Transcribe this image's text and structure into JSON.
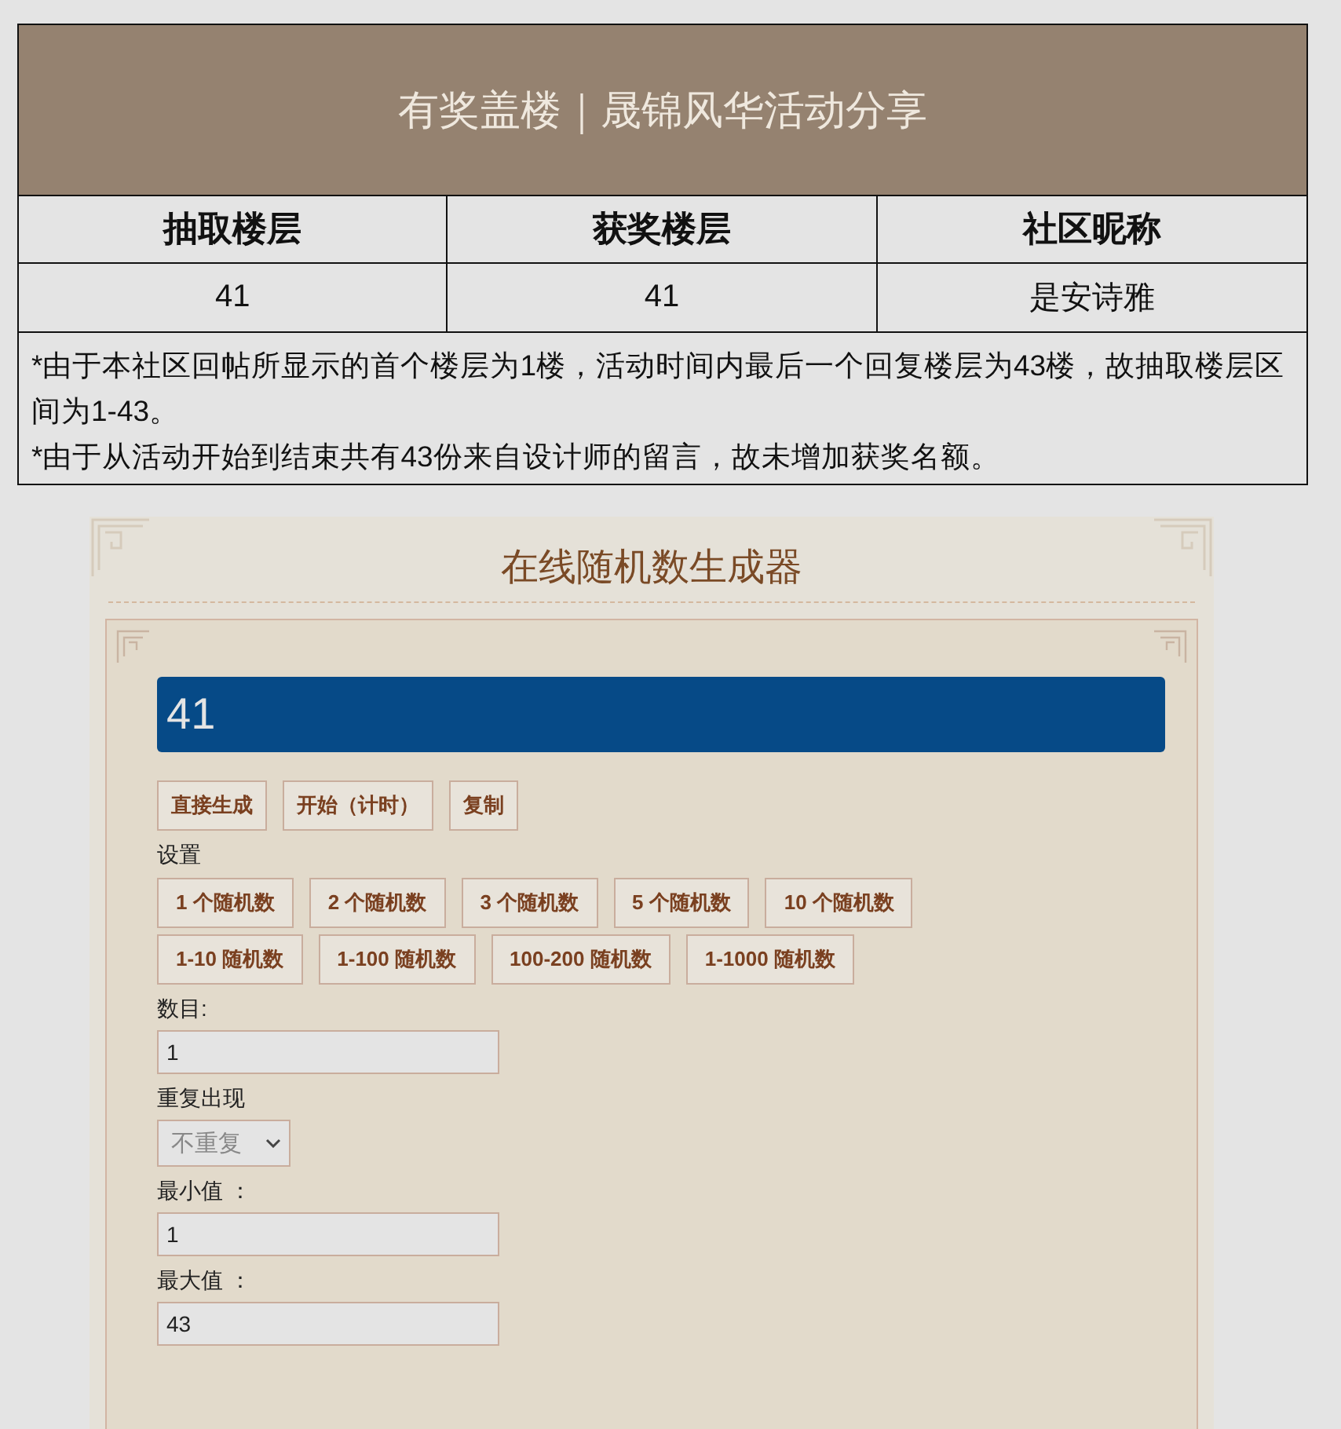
{
  "announcement": {
    "title": "有奖盖楼｜晟锦风华活动分享",
    "columns": [
      "抽取楼层",
      "获奖楼层",
      "社区昵称"
    ],
    "rows": [
      [
        "41",
        "41",
        "是安诗雅"
      ]
    ],
    "notes": [
      "*由于本社区回帖所显示的首个楼层为1楼，活动时间内最后一个回复楼层为43楼，故抽取楼层区间为1-43。",
      "*由于从活动开始到结束共有43份来自设计师的留言，故未增加获奖名额。"
    ]
  },
  "generator": {
    "title": "在线随机数生成器",
    "result": "41",
    "actions": [
      "直接生成",
      "开始（计时）",
      "复制"
    ],
    "settings_label": "设置",
    "count_presets": [
      "1 个随机数",
      "2 个随机数",
      "3 个随机数",
      "5 个随机数",
      "10 个随机数"
    ],
    "range_presets": [
      "1-10 随机数",
      "1-100 随机数",
      "100-200 随机数",
      "1-1000 随机数"
    ],
    "fields": [
      {
        "kind": "input",
        "label": "数目:",
        "value": "1"
      },
      {
        "kind": "select",
        "label": "重复出现",
        "value": "不重复"
      },
      {
        "kind": "input",
        "label": "最小值  ：",
        "value": "1"
      },
      {
        "kind": "input",
        "label": "最大值  ：",
        "value": "43"
      }
    ]
  }
}
